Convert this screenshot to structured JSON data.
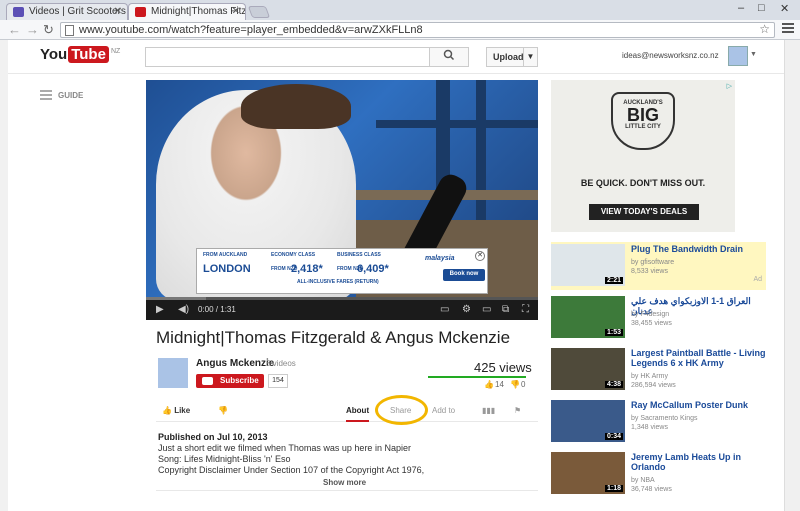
{
  "browser": {
    "tabs": [
      {
        "label": "Videos | Grit Scooters NZ",
        "favicon_color": "#5b4fb5"
      },
      {
        "label": "Midnight|Thomas Fitzgera",
        "favicon_color": "#cc181e"
      }
    ],
    "url": "www.youtube.com/watch?feature=player_embedded&v=arwZXkFLLn8",
    "window_controls": [
      "–",
      "□",
      "✕"
    ]
  },
  "header": {
    "logo_you": "You",
    "logo_tube": "Tube",
    "logo_region": "NZ",
    "upload_label": "Upload",
    "account_email": "ideas@newsworksnz.co.nz",
    "guide_label": "GUIDE"
  },
  "player": {
    "time": "0:00 / 1:31",
    "progress": 0.0
  },
  "overlay_ad": {
    "from": "FROM AUCKLAND",
    "economy": "ECONOMY CLASS",
    "business": "BUSINESS CLASS",
    "city": "LONDON",
    "fromnzd1": "FROM NZD",
    "price_economy": "2,418*",
    "fromnzd2": "FROM NZD",
    "price_business": "6,409*",
    "fares_note": "ALL-INCLUSIVE FARES (RETURN)",
    "brand": "malaysia",
    "book": "Book now",
    "close": "✕"
  },
  "video": {
    "title": "Midnight|Thomas Fitzgerald & Angus Mckenzie",
    "channel": "Angus Mckenzie",
    "channel_videos": "8 videos",
    "subscribe_label": "Subscribe",
    "subscriber_count": "154",
    "views": "425 views",
    "likes": "14",
    "dislikes": "0",
    "like_label": "Like",
    "tabs": [
      "About",
      "Share",
      "Add to"
    ],
    "published": "Published on Jul 10, 2013",
    "description": [
      "Just a short edit we filmed when Thomas was up here in Napier",
      "Song: Lifes Midnight-Bliss 'n' Eso",
      "Copyright Disclaimer Under Section 107 of the Copyright Act 1976,"
    ],
    "show_more": "Show more"
  },
  "side_ad": {
    "badge_top": "AUCKLAND'S",
    "badge_big": "BIG",
    "badge_bottom": "LITTLE CITY",
    "tagline": "BE QUICK. DON'T MISS OUT.",
    "cta": "VIEW TODAY'S DEALS"
  },
  "recommendations": [
    {
      "title": "Plug The Bandwidth Drain",
      "by": "by gfisoftware",
      "views": "8,533 views",
      "duration": "2:21",
      "ad_label": "Ad",
      "highlight": true
    },
    {
      "title": "العراق 1-1 الاوزبكواي هدف علي عدنان",
      "by": "by F4design",
      "views": "38,455 views",
      "duration": "1:53"
    },
    {
      "title": "Largest Paintball Battle - Living Legends 6 x HK Army",
      "by": "by HK Army",
      "views": "286,594 views",
      "duration": "4:38"
    },
    {
      "title": "Ray McCallum Poster Dunk",
      "by": "by Sacramento Kings",
      "views": "1,348 views",
      "duration": "0:34"
    },
    {
      "title": "Jeremy Lamb Heats Up in Orlando",
      "by": "by NBA",
      "views": "36,748 views",
      "duration": "1:18"
    }
  ]
}
